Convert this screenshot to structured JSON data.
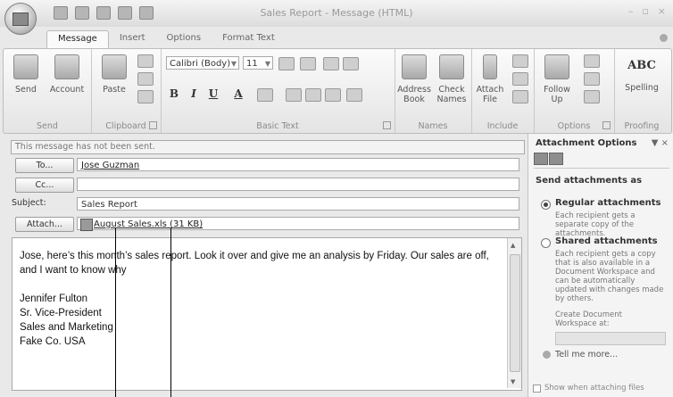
{
  "window": {
    "title": "Sales Report - Message (HTML)",
    "controls": {
      "minimize": "–",
      "maximize": "▫",
      "close": "×"
    }
  },
  "tabs": [
    "Message",
    "Insert",
    "Options",
    "Format Text"
  ],
  "ribbon": {
    "send": {
      "send": "Send",
      "account": "Account",
      "group": "Send"
    },
    "clipboard": {
      "paste": "Paste",
      "group": "Clipboard"
    },
    "basic_text": {
      "font": "Calibri (Body)",
      "size": "11",
      "bold": "B",
      "italic": "I",
      "underline": "U",
      "font_color": "A",
      "group": "Basic Text"
    },
    "names": {
      "address_book_1": "Address",
      "address_book_2": "Book",
      "check_names_1": "Check",
      "check_names_2": "Names",
      "group": "Names"
    },
    "include": {
      "attach_1": "Attach",
      "attach_2": "File",
      "group": "Include"
    },
    "options": {
      "follow_up_1": "Follow",
      "follow_up_2": "Up",
      "group": "Options"
    },
    "proofing": {
      "spelling": "Spelling",
      "abc": "ABC",
      "group": "Proofing"
    }
  },
  "message": {
    "info": "This message has not been sent.",
    "to_button": "To...",
    "to_value": "Jose Guzman",
    "cc_button": "Cc...",
    "cc_value": "",
    "subject_label": "Subject:",
    "subject_value": "Sales Report",
    "attach_button": "Attach...",
    "attachment": "August Sales.xls (31 KB)",
    "body_lines": [
      "Jose, here’s this month’s sales report. Look it over and give me an analysis by Friday. Our sales are off,",
      "and I want to know why",
      "Jennifer Fulton",
      "Sr. Vice-President",
      "Sales and Marketing",
      "Fake Co. USA"
    ]
  },
  "pane": {
    "title": "Attachment Options",
    "ctl": "▼ ×",
    "section": "Send attachments as",
    "regular_title": "Regular attachments",
    "regular_desc": "Each recipient gets a separate copy of the attachments.",
    "shared_title": "Shared attachments",
    "shared_desc": "Each recipient gets a copy that is also available in a Document Workspace and can be automatically updated with changes made by others.",
    "workspace_label": "Create Document Workspace at:",
    "tell_me": "Tell me more...",
    "show_checkbox": "Show when attaching files"
  }
}
